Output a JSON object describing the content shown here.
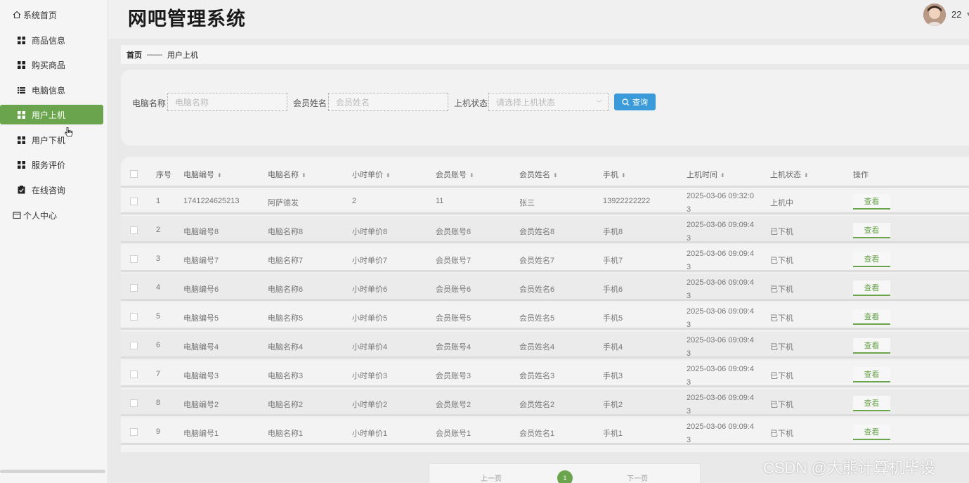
{
  "header": {
    "title": "网吧管理系统",
    "username": "22"
  },
  "sidebar": {
    "home": "系统首页",
    "items": [
      {
        "label": "商品信息",
        "icon": "grid-icon"
      },
      {
        "label": "购买商品",
        "icon": "grid-icon"
      },
      {
        "label": "电脑信息",
        "icon": "list-icon"
      },
      {
        "label": "用户上机",
        "icon": "grid-icon",
        "active": true
      },
      {
        "label": "用户下机",
        "icon": "grid-icon"
      },
      {
        "label": "服务评价",
        "icon": "grid-icon"
      },
      {
        "label": "在线咨询",
        "icon": "clipboard-check-icon"
      }
    ],
    "profile": "个人中心"
  },
  "breadcrumb": {
    "home": "首页",
    "separator": "——",
    "current": "用户上机"
  },
  "search": {
    "computer_label": "电脑名称",
    "computer_placeholder": "电脑名称",
    "member_label": "会员姓名",
    "member_placeholder": "会员姓名",
    "status_label": "上机状态",
    "status_placeholder": "请选择上机状态",
    "button": "查询"
  },
  "table": {
    "headers": [
      "序号",
      "电脑编号",
      "电脑名称",
      "小时单价",
      "会员账号",
      "会员姓名",
      "手机",
      "上机时间",
      "上机状态",
      "操作"
    ],
    "rows": [
      [
        "1",
        "1741224625213",
        "阿萨德发",
        "2",
        "11",
        "张三",
        "13922222222",
        "2025-03-06 09:32:03",
        "上机中",
        "查看"
      ],
      [
        "2",
        "电脑编号8",
        "电脑名称8",
        "小时单价8",
        "会员账号8",
        "会员姓名8",
        "手机8",
        "2025-03-06 09:09:43",
        "已下机",
        "查看"
      ],
      [
        "3",
        "电脑编号7",
        "电脑名称7",
        "小时单价7",
        "会员账号7",
        "会员姓名7",
        "手机7",
        "2025-03-06 09:09:43",
        "已下机",
        "查看"
      ],
      [
        "4",
        "电脑编号6",
        "电脑名称6",
        "小时单价6",
        "会员账号6",
        "会员姓名6",
        "手机6",
        "2025-03-06 09:09:43",
        "已下机",
        "查看"
      ],
      [
        "5",
        "电脑编号5",
        "电脑名称5",
        "小时单价5",
        "会员账号5",
        "会员姓名5",
        "手机5",
        "2025-03-06 09:09:43",
        "已下机",
        "查看"
      ],
      [
        "6",
        "电脑编号4",
        "电脑名称4",
        "小时单价4",
        "会员账号4",
        "会员姓名4",
        "手机4",
        "2025-03-06 09:09:43",
        "已下机",
        "查看"
      ],
      [
        "7",
        "电脑编号3",
        "电脑名称3",
        "小时单价3",
        "会员账号3",
        "会员姓名3",
        "手机3",
        "2025-03-06 09:09:43",
        "已下机",
        "查看"
      ],
      [
        "8",
        "电脑编号2",
        "电脑名称2",
        "小时单价2",
        "会员账号2",
        "会员姓名2",
        "手机2",
        "2025-03-06 09:09:43",
        "已下机",
        "查看"
      ],
      [
        "9",
        "电脑编号1",
        "电脑名称1",
        "小时单价1",
        "会员账号1",
        "会员姓名1",
        "手机1",
        "2025-03-06 09:09:43",
        "已下机",
        "查看"
      ]
    ]
  },
  "pagination": {
    "prev": "上一页",
    "current": "1",
    "next": "下一页"
  },
  "watermark": "CSDN @大熊计算机毕设",
  "colors": {
    "accent": "#6aa44d",
    "button": "#3b9ad9"
  }
}
